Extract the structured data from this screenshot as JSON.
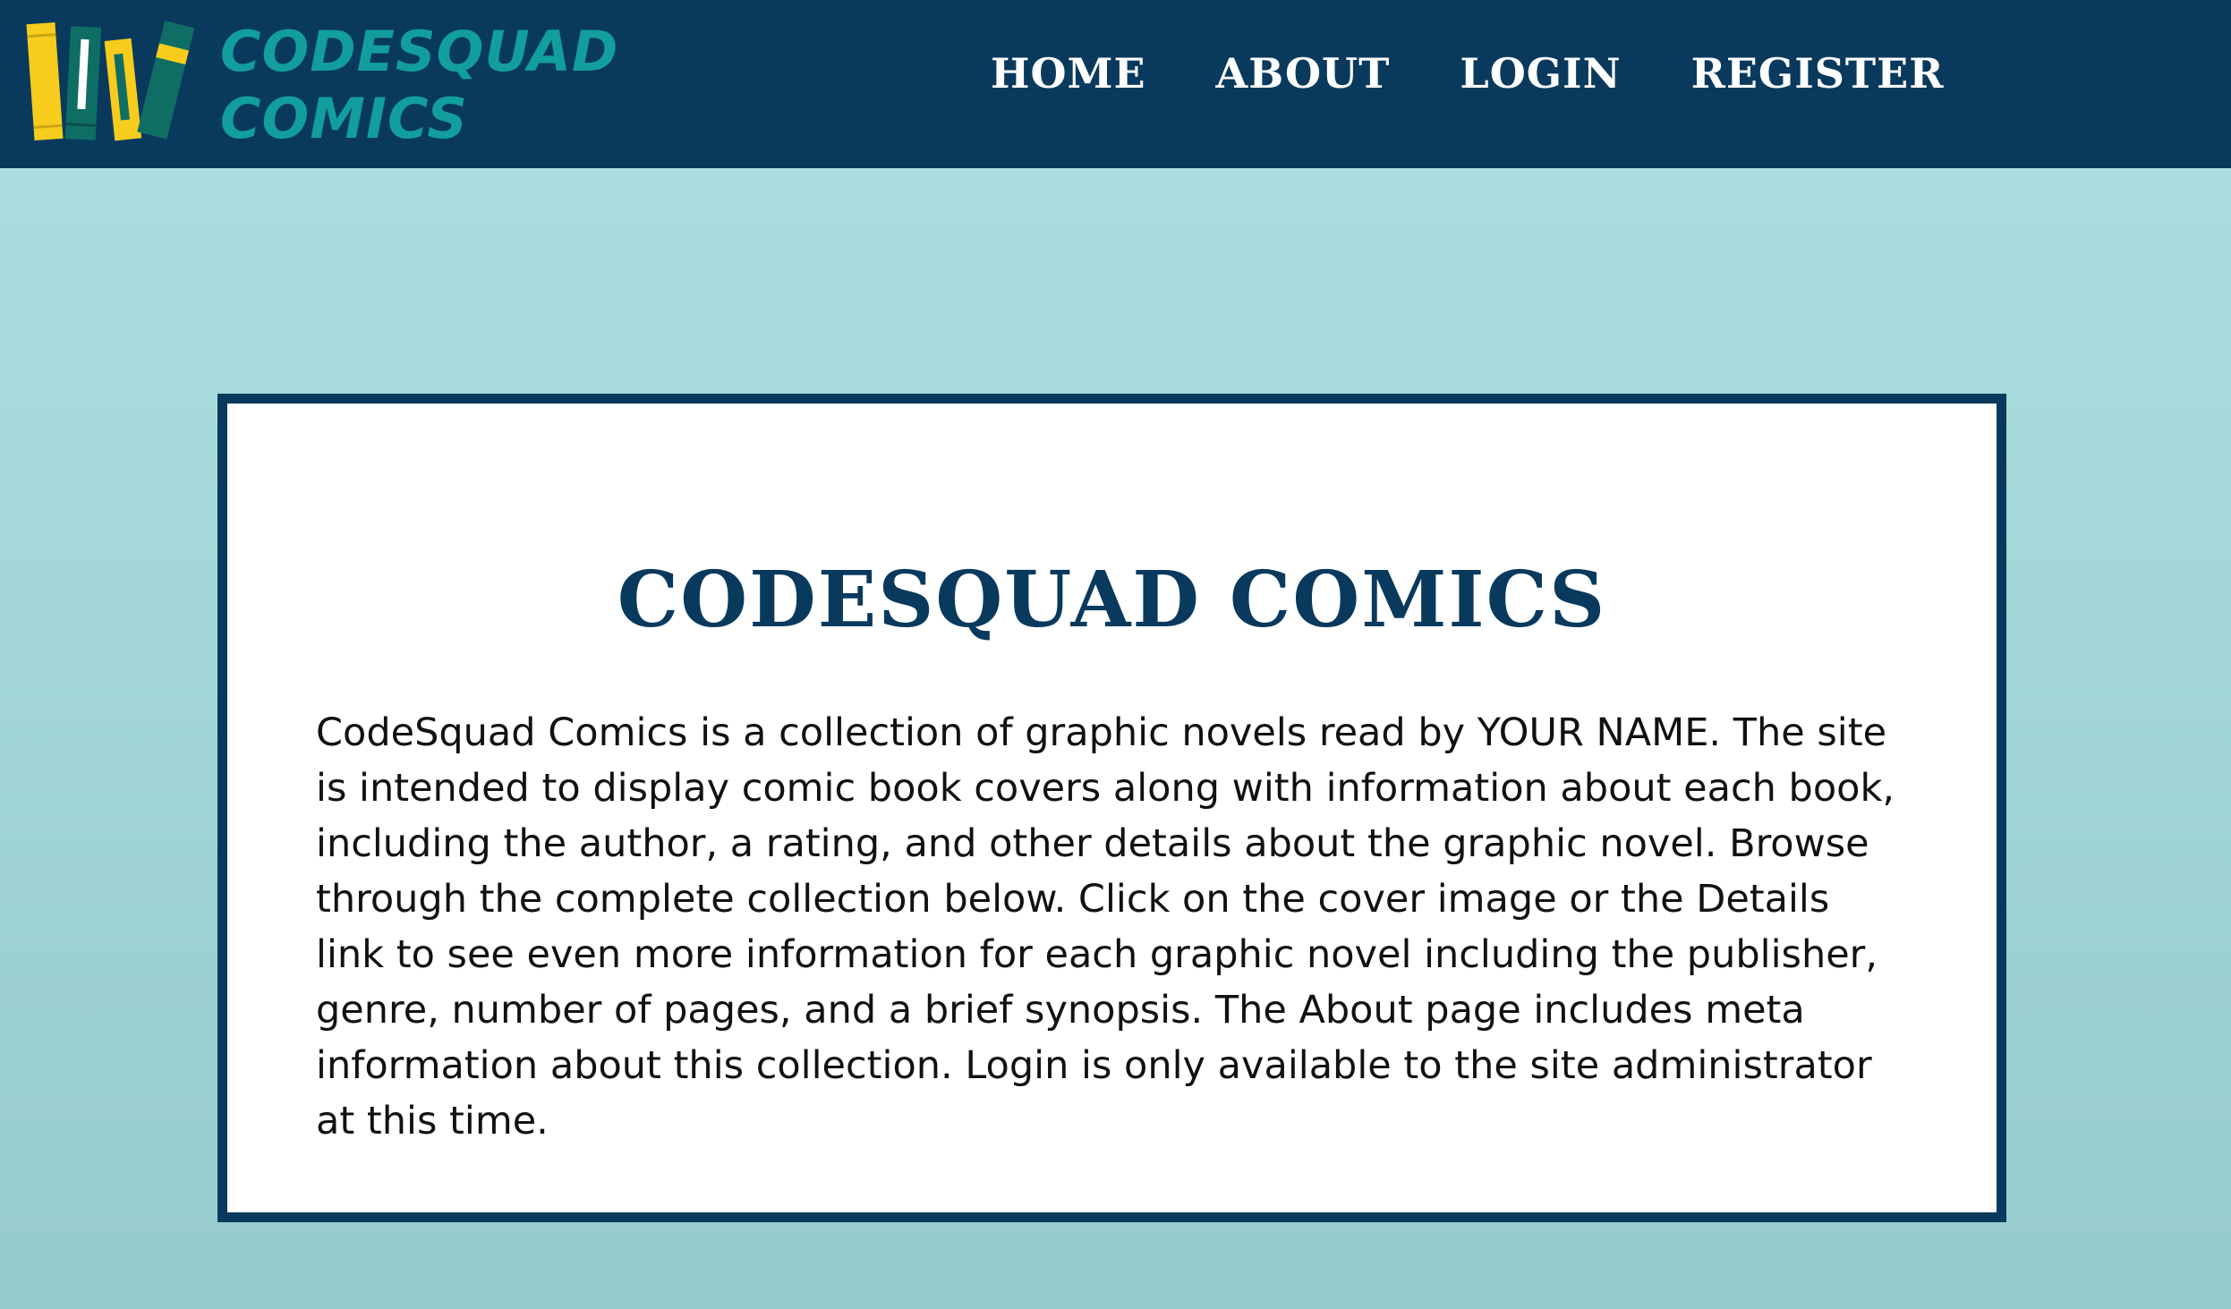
{
  "brand": {
    "logo_line1": "CODESQUAD",
    "logo_line2": "COMICS",
    "logo_color": "#139e9e",
    "book_colors": [
      "#f7cc1d",
      "#0f6e64",
      "#ffffff",
      "#f7cc1d",
      "#0f6e64"
    ]
  },
  "nav": {
    "items": [
      {
        "label": "HOME"
      },
      {
        "label": "ABOUT"
      },
      {
        "label": "LOGIN"
      },
      {
        "label": "REGISTER"
      }
    ]
  },
  "main": {
    "title": "CODESQUAD COMICS",
    "description": "CodeSquad Comics is a collection of graphic novels read by YOUR NAME. The site is intended to display comic book covers along with information about each book, including the author, a rating, and other details about the graphic novel. Browse through the complete collection below. Click on the cover image or the Details link to see even more information for each graphic novel including the publisher, genre, number of pages, and a brief synopsis. The About page includes meta information about this collection. Login is only available to the site administrator at this time."
  },
  "colors": {
    "navbar_bg": "#093a5e",
    "page_bg_top": "#afdfe0",
    "page_bg_bottom": "#96cbce",
    "card_border": "#093a5e",
    "title_color": "#093a5e",
    "nav_text": "#ffffff"
  }
}
